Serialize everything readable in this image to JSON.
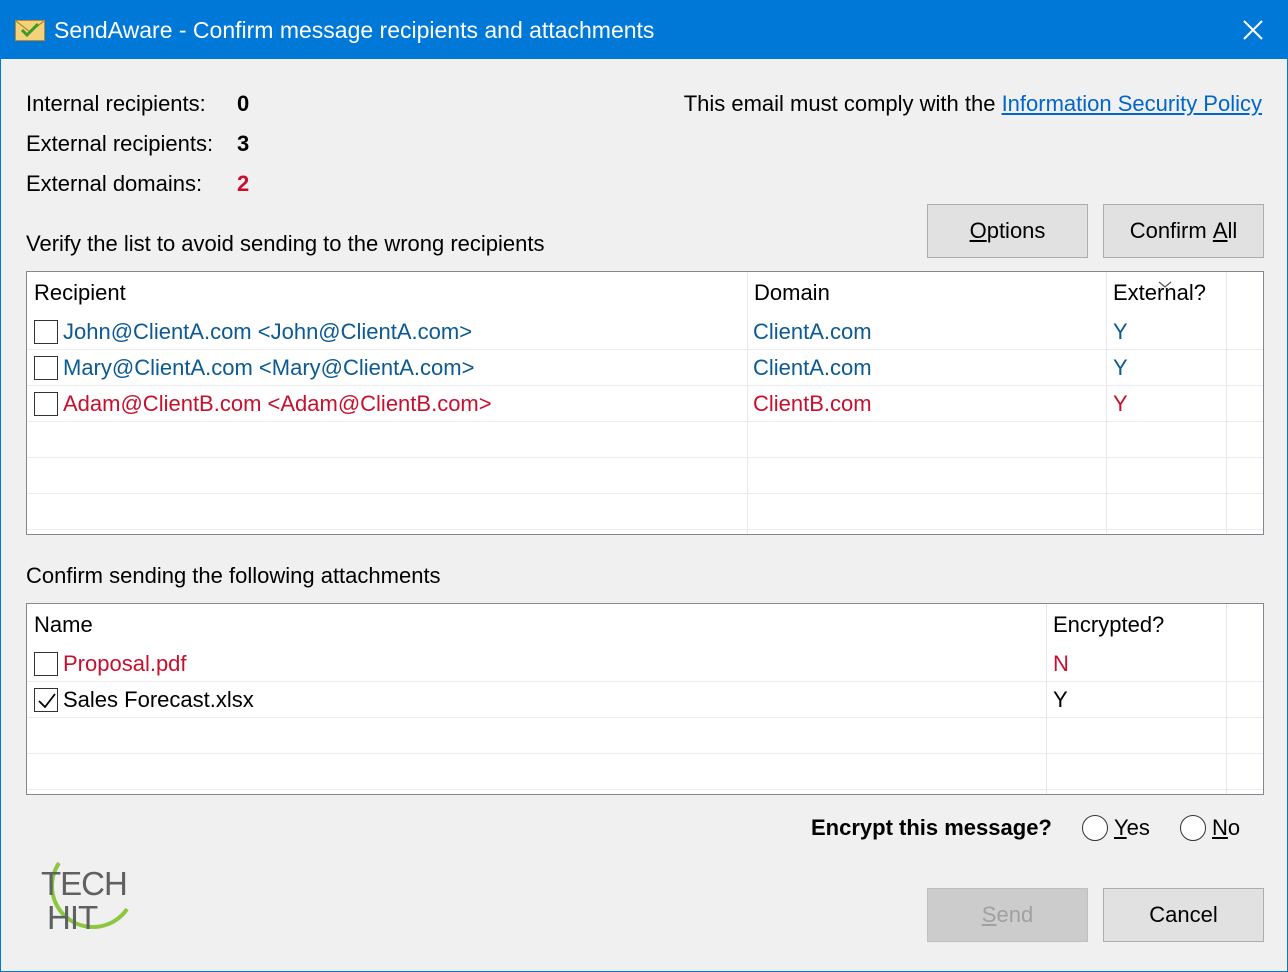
{
  "window": {
    "title": "SendAware - Confirm message recipients and attachments"
  },
  "stats": {
    "internal_label": "Internal recipients:",
    "internal_value": "0",
    "external_label": "External recipients:",
    "external_value": "3",
    "domains_label": "External domains:",
    "domains_value": "2"
  },
  "policy": {
    "prefix": "This email must comply with the ",
    "link": "Information Security Policy"
  },
  "recipients": {
    "section_label": "Verify the list to avoid sending to the wrong recipients",
    "options_button": "Options",
    "confirm_all_button_pre": "Confirm ",
    "confirm_all_button_u": "A",
    "confirm_all_button_post": "ll",
    "columns": [
      "Recipient",
      "Domain",
      "External?"
    ],
    "rows": [
      {
        "recipient": "John@ClientA.com <John@ClientA.com>",
        "domain": "ClientA.com",
        "external": "Y",
        "checked": false,
        "color": "blue"
      },
      {
        "recipient": "Mary@ClientA.com <Mary@ClientA.com>",
        "domain": "ClientA.com",
        "external": "Y",
        "checked": false,
        "color": "blue"
      },
      {
        "recipient": "Adam@ClientB.com <Adam@ClientB.com>",
        "domain": "ClientB.com",
        "external": "Y",
        "checked": false,
        "color": "red"
      }
    ]
  },
  "attachments": {
    "section_label": "Confirm sending the following attachments",
    "columns": [
      "Name",
      "Encrypted?"
    ],
    "rows": [
      {
        "name": "Proposal.pdf",
        "encrypted": "N",
        "checked": false,
        "color": "red"
      },
      {
        "name": "Sales Forecast.xlsx",
        "encrypted": "Y",
        "checked": true,
        "color": "black"
      }
    ]
  },
  "encrypt": {
    "label": "Encrypt this message?",
    "yes_u": "Y",
    "yes_rest": "es",
    "no_u": "N",
    "no_rest": "o",
    "selected": "none"
  },
  "footer": {
    "send_u": "S",
    "send_rest": "end",
    "cancel": "Cancel"
  },
  "logo": {
    "line1": "TECH",
    "line2": "HIT"
  },
  "colors": {
    "titlebar": "#0078d7",
    "blue_text": "#0b5a94",
    "red_text": "#c8102e",
    "link": "#0066cc",
    "logo_green": "#8dc63f"
  }
}
